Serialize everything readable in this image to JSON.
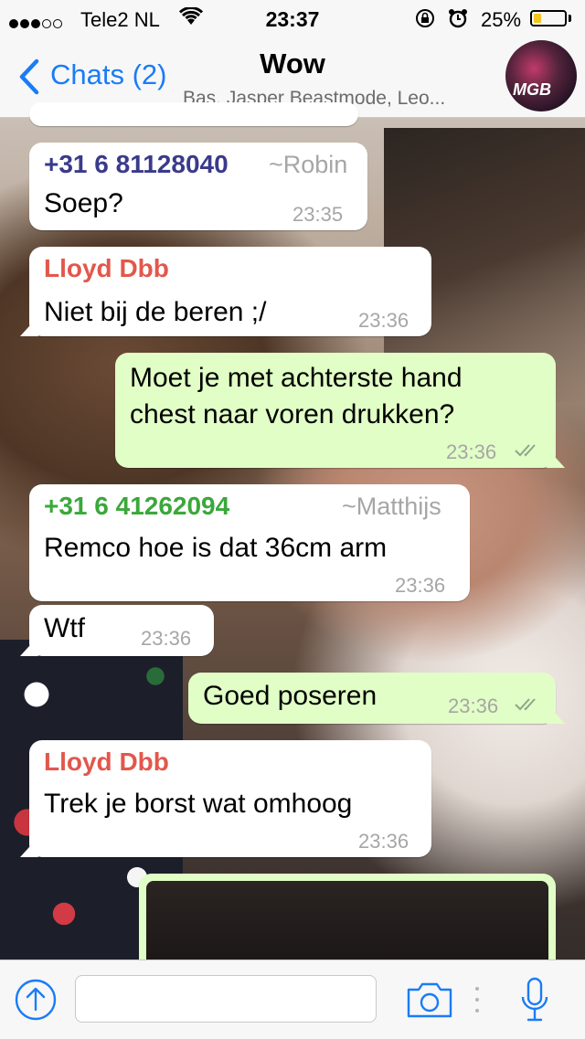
{
  "status_bar": {
    "carrier": "Tele2 NL",
    "time": "23:37",
    "battery_percent": "25%",
    "battery_level": 0.25,
    "signal_filled": 3,
    "signal_total": 5
  },
  "nav": {
    "back_label": "Chats (2)",
    "title": "Wow",
    "subtitle": "Bas, Jasper Beastmode, Leo...",
    "avatar_text": "MGB"
  },
  "messages": [
    {
      "direction": "incoming",
      "sender": "+31 6 81128040",
      "alias": "~Robin",
      "sender_color": "#3a3a8c",
      "text": "Soep?",
      "time": "23:35"
    },
    {
      "direction": "incoming",
      "sender": "Lloyd Dbb",
      "sender_color": "#e2574c",
      "text": "Niet bij de beren ;/",
      "time": "23:36"
    },
    {
      "direction": "outgoing",
      "lines": [
        "Moet je met achterste hand",
        "chest naar voren drukken?"
      ],
      "time": "23:36",
      "status": "read"
    },
    {
      "direction": "incoming",
      "sender": "+31 6 41262094",
      "alias": "~Matthijs",
      "sender_color": "#3aa83a",
      "text": "Remco hoe is dat 36cm arm",
      "time": "23:36"
    },
    {
      "direction": "incoming",
      "text": "Wtf",
      "time": "23:36"
    },
    {
      "direction": "outgoing",
      "text": "Goed poseren",
      "time": "23:36",
      "status": "read"
    },
    {
      "direction": "incoming",
      "sender": "Lloyd Dbb",
      "sender_color": "#e2574c",
      "text": "Trek je borst wat omhoog",
      "time": "23:36"
    }
  ],
  "input": {
    "placeholder": ""
  },
  "colors": {
    "accent": "#1a7cf6",
    "outgoing_bubble": "#e1fec6",
    "incoming_bubble": "#ffffff",
    "timestamp": "#a6a6a6",
    "read_check": "#8aa88a"
  },
  "icons": {
    "back": "chevron-left-icon",
    "share": "share-arrow-icon",
    "camera": "camera-icon",
    "mic": "microphone-icon",
    "wifi": "wifi-icon",
    "lock": "rotation-lock-icon",
    "alarm": "alarm-icon"
  }
}
